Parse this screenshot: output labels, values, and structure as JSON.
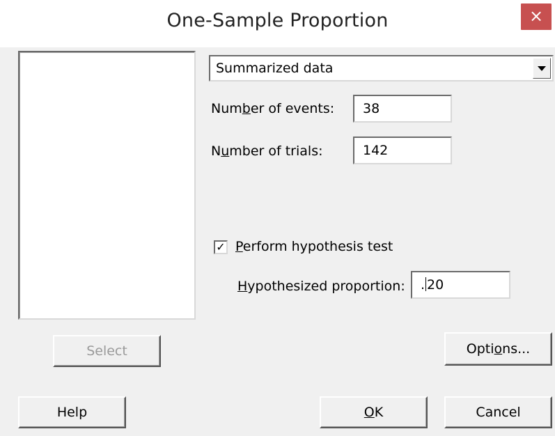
{
  "window": {
    "title": "One-Sample Proportion",
    "close_glyph": "×"
  },
  "left_panel": {
    "select_label": "Select",
    "help_label": "Help"
  },
  "data_mode": {
    "selected": "Summarized data"
  },
  "fields": {
    "events": {
      "pre": "Num",
      "ul": "b",
      "post": "er of events:",
      "value": "38"
    },
    "trials": {
      "pre": "N",
      "ul": "u",
      "post": "mber of trials:",
      "value": "142"
    }
  },
  "hypothesis": {
    "checked": true,
    "check_glyph": "✓",
    "label_ul": "P",
    "label_rest": "erform hypothesis test",
    "prop_ul": "H",
    "prop_rest": "ypothesized proportion:",
    "value_before_caret": ".",
    "value_after_caret": "20"
  },
  "buttons": {
    "options_pre": "Opti",
    "options_ul": "o",
    "options_post": "ns...",
    "ok_ul": "O",
    "ok_rest": "K",
    "cancel": "Cancel"
  }
}
